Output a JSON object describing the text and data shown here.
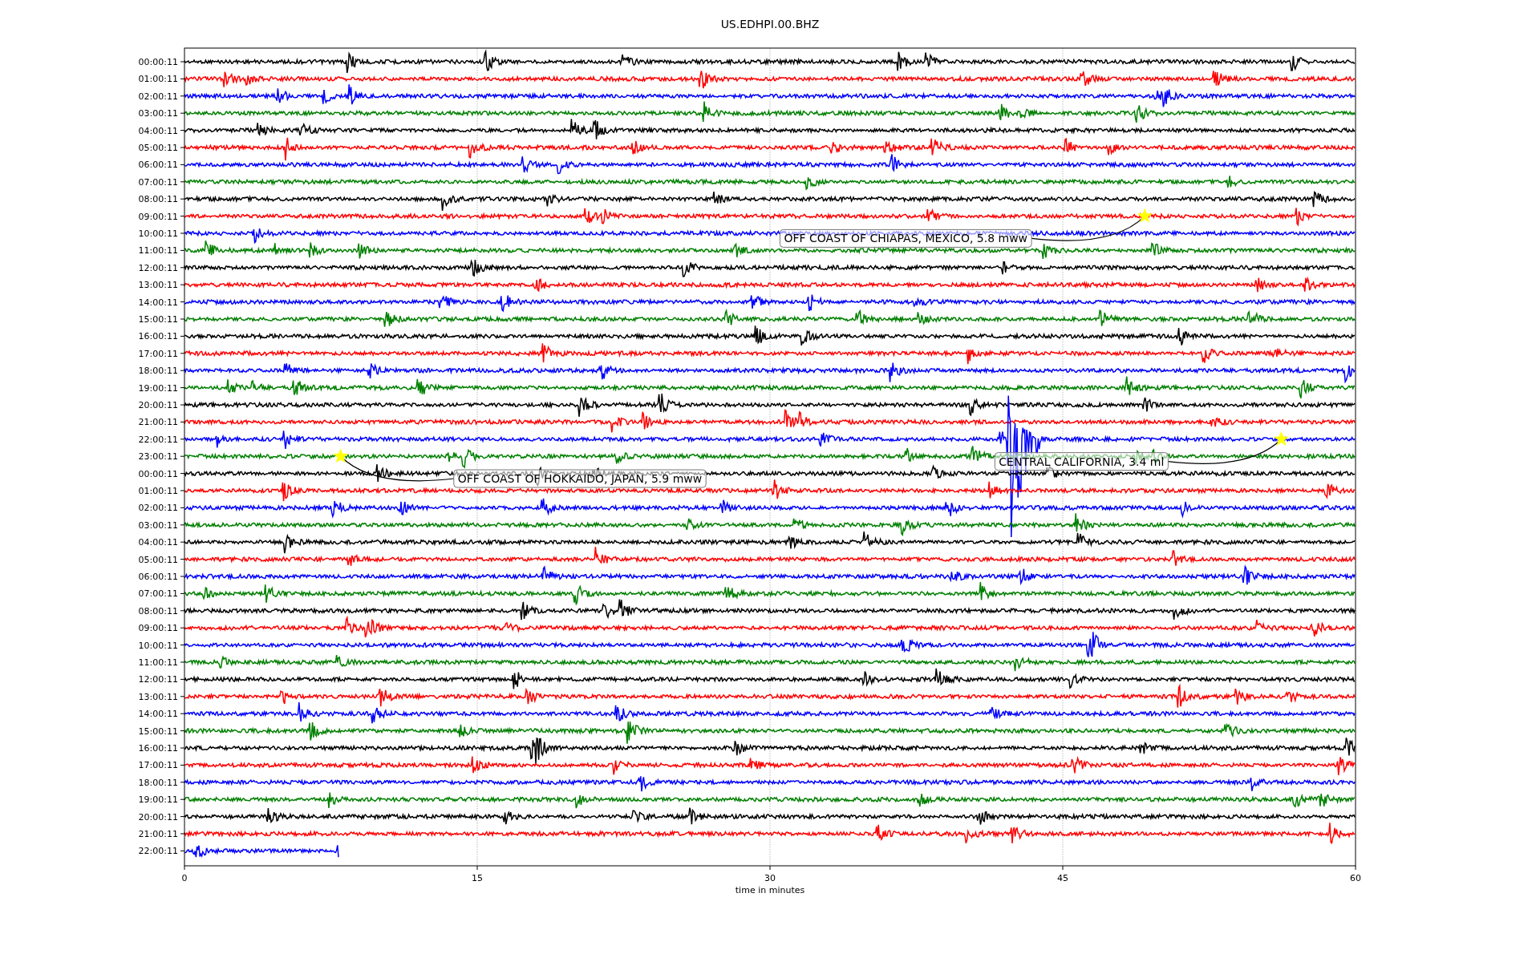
{
  "title": "US.EDHPI.00.BHZ",
  "xlabel": "time in minutes",
  "xticks": [
    "0",
    "15",
    "30",
    "45",
    "60"
  ],
  "rows": [
    {
      "label": "00:00:11",
      "color": "#000000",
      "level": 1
    },
    {
      "label": "01:00:11",
      "color": "#ff0000",
      "level": 1
    },
    {
      "label": "02:00:11",
      "color": "#0000ff",
      "level": 1
    },
    {
      "label": "03:00:11",
      "color": "#008000",
      "level": 1
    },
    {
      "label": "04:00:11",
      "color": "#000000",
      "level": 1
    },
    {
      "label": "05:00:11",
      "color": "#ff0000",
      "level": 1
    },
    {
      "label": "06:00:11",
      "color": "#0000ff",
      "level": 1
    },
    {
      "label": "07:00:11",
      "color": "#008000",
      "level": 1
    },
    {
      "label": "08:00:11",
      "color": "#000000",
      "level": 1
    },
    {
      "label": "09:00:11",
      "color": "#ff0000",
      "level": 1
    },
    {
      "label": "10:00:11",
      "color": "#0000ff",
      "level": 1
    },
    {
      "label": "11:00:11",
      "color": "#008000",
      "level": 1
    },
    {
      "label": "12:00:11",
      "color": "#000000",
      "level": 1
    },
    {
      "label": "13:00:11",
      "color": "#ff0000",
      "level": 1
    },
    {
      "label": "14:00:11",
      "color": "#0000ff",
      "level": 1
    },
    {
      "label": "15:00:11",
      "color": "#008000",
      "level": 1
    },
    {
      "label": "16:00:11",
      "color": "#000000",
      "level": 1
    },
    {
      "label": "17:00:11",
      "color": "#ff0000",
      "level": 1
    },
    {
      "label": "18:00:11",
      "color": "#0000ff",
      "level": 1
    },
    {
      "label": "19:00:11",
      "color": "#008000",
      "level": 1
    },
    {
      "label": "20:00:11",
      "color": "#000000",
      "level": 1
    },
    {
      "label": "21:00:11",
      "color": "#ff0000",
      "level": 1
    },
    {
      "label": "22:00:11",
      "color": "#0000ff",
      "level": 1
    },
    {
      "label": "23:00:11",
      "color": "#008000",
      "level": 1
    },
    {
      "label": "00:00:11",
      "color": "#000000",
      "level": 1
    },
    {
      "label": "01:00:11",
      "color": "#ff0000",
      "level": 1
    },
    {
      "label": "02:00:11",
      "color": "#0000ff",
      "level": 1
    },
    {
      "label": "03:00:11",
      "color": "#008000",
      "level": 1
    },
    {
      "label": "04:00:11",
      "color": "#000000",
      "level": 1
    },
    {
      "label": "05:00:11",
      "color": "#ff0000",
      "level": 1
    },
    {
      "label": "06:00:11",
      "color": "#0000ff",
      "level": 1
    },
    {
      "label": "07:00:11",
      "color": "#008000",
      "level": 1
    },
    {
      "label": "08:00:11",
      "color": "#000000",
      "level": 1
    },
    {
      "label": "09:00:11",
      "color": "#ff0000",
      "level": 1
    },
    {
      "label": "10:00:11",
      "color": "#0000ff",
      "level": 1
    },
    {
      "label": "11:00:11",
      "color": "#008000",
      "level": 1
    },
    {
      "label": "12:00:11",
      "color": "#000000",
      "level": 1
    },
    {
      "label": "13:00:11",
      "color": "#ff0000",
      "level": 1
    },
    {
      "label": "14:00:11",
      "color": "#0000ff",
      "level": 1
    },
    {
      "label": "15:00:11",
      "color": "#008000",
      "level": 1
    },
    {
      "label": "16:00:11",
      "color": "#000000",
      "level": 1
    },
    {
      "label": "17:00:11",
      "color": "#ff0000",
      "level": 1
    },
    {
      "label": "18:00:11",
      "color": "#0000ff",
      "level": 1
    },
    {
      "label": "19:00:11",
      "color": "#008000",
      "level": 1
    },
    {
      "label": "20:00:11",
      "color": "#000000",
      "level": 1
    },
    {
      "label": "21:00:11",
      "color": "#ff0000",
      "level": 1
    },
    {
      "label": "22:00:11",
      "color": "#0000ff",
      "level": 0.132
    }
  ],
  "events": [
    {
      "label": "OFF COAST OF CHIAPAS, MEXICO, 5.8 mww"
    },
    {
      "label": "CENTRAL CALIFORNIA, 3.4 ml"
    },
    {
      "label": "OFF COAST OF HOKKAIDO, JAPAN, 5.9 mww"
    }
  ]
}
